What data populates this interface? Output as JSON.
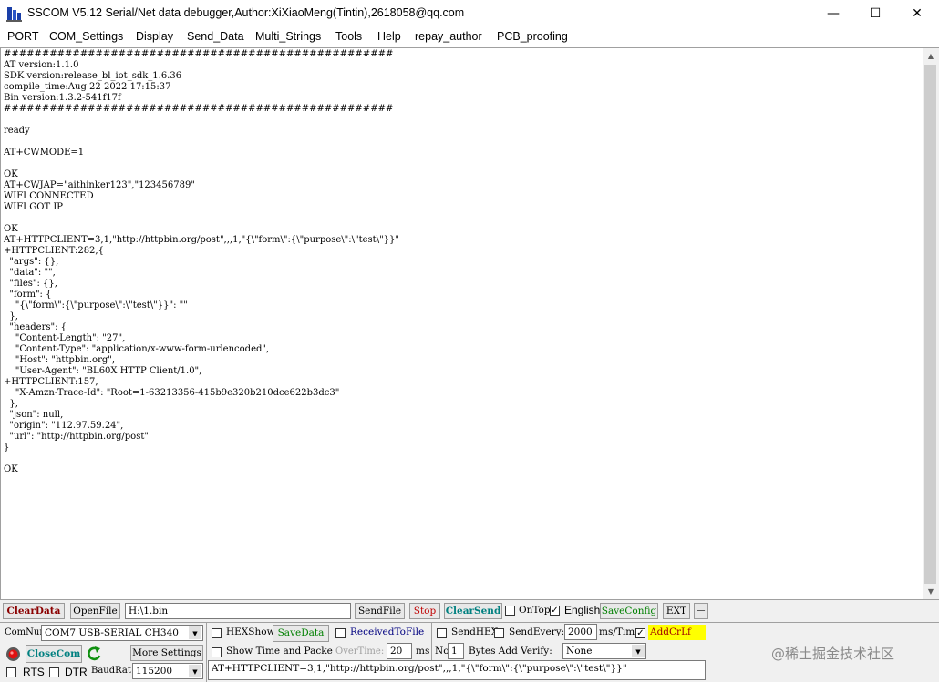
{
  "window": {
    "title": "SSCOM V5.12 Serial/Net data debugger,Author:XiXiaoMeng(Tintin),2618058@qq.com",
    "minimize": "—",
    "maximize": "☐",
    "close": "✕"
  },
  "menu": [
    "PORT",
    "COM_Settings",
    "Display",
    "Send_Data",
    "Multi_Strings",
    "Tools",
    "Help",
    "repay_author",
    "PCB_proofing"
  ],
  "output": {
    "text": "###################################################\nAT version:1.1.0\nSDK version:release_bl_iot_sdk_1.6.36\ncompile_time:Aug 22 2022 17:15:37\nBin version:1.3.2-541f17f\n###################################################\n\nready\n\nAT+CWMODE=1\n\nOK\nAT+CWJAP=\"aithinker123\",\"123456789\"\nWIFI CONNECTED\nWIFI GOT IP\n\nOK\nAT+HTTPCLIENT=3,1,\"http://httpbin.org/post\",,,1,\"{\\\"form\\\":{\\\"purpose\\\":\\\"test\\\"}}\"\n+HTTPCLIENT:282,{\n  \"args\": {},\n  \"data\": \"\",\n  \"files\": {},\n  \"form\": {\n    \"{\\\"form\\\":{\\\"purpose\\\":\\\"test\\\"}}\": \"\"\n  },\n  \"headers\": {\n    \"Content-Length\": \"27\",\n    \"Content-Type\": \"application/x-www-form-urlencoded\",\n    \"Host\": \"httpbin.org\",\n    \"User-Agent\": \"BL60X HTTP Client/1.0\",\n+HTTPCLIENT:157,\n    \"X-Amzn-Trace-Id\": \"Root=1-63213356-415b9e320b210dce622b3dc3\"\n  },\n  \"json\": null,\n  \"origin\": \"112.97.59.24\",\n  \"url\": \"http://httpbin.org/post\"\n}\n\nOK"
  },
  "row1": {
    "clear_data": "ClearData",
    "open_file": "OpenFile",
    "file_path": "H:\\1.bin",
    "send_file": "SendFile",
    "stop": "Stop",
    "clear_send": "ClearSend",
    "on_top": "OnTop",
    "english": "English",
    "english_checked": "✓",
    "save_config": "SaveConfig",
    "ext": "EXT",
    "dash": "—"
  },
  "row2": {
    "com_num_label": "ComNum",
    "com_port": "COM7 USB-SERIAL CH340",
    "hex_show": "HEXShow",
    "save_data": "SaveData",
    "received_to_file": "ReceivedToFile",
    "send_hex": "SendHEX",
    "send_every": "SendEvery:",
    "interval": "2000",
    "interval_unit": "ms/Tim",
    "add_crlf": "AddCrLf",
    "add_crlf_checked": "✓"
  },
  "row3": {
    "close_com": "CloseCom",
    "more_settings": "More Settings",
    "show_time": "Show Time and Packe",
    "overtime_label": "OverTime:",
    "overtime": "20",
    "overtime_unit": "ms",
    "no_label": "No",
    "no_value": "1",
    "bytes_add_verify": "Bytes Add Verify:",
    "verify_value": "None"
  },
  "row4": {
    "rts": "RTS",
    "dtr": "DTR",
    "baud_label": "BaudRat",
    "baud": "115200",
    "send_text": "AT+HTTPCLIENT=3,1,\"http://httpbin.org/post\",,,1,\"{\\\"form\\\":{\\\"purpose\\\":\\\"test\\\"}}\""
  },
  "watermark": "@稀土掘金技术社区",
  "colors": {
    "clear_data": "#8b0000",
    "received_to_file": "#000080",
    "save_green": "#008000",
    "stop": "#c00000",
    "clear_send": "#008080",
    "add_crlf_bg": "#ffff00",
    "add_crlf_text": "#a00000"
  },
  "icons": [
    "app-icon",
    "minimize-icon",
    "maximize-icon",
    "close-icon",
    "com-status-icon",
    "refresh-icon",
    "chevron-down-icon"
  ]
}
